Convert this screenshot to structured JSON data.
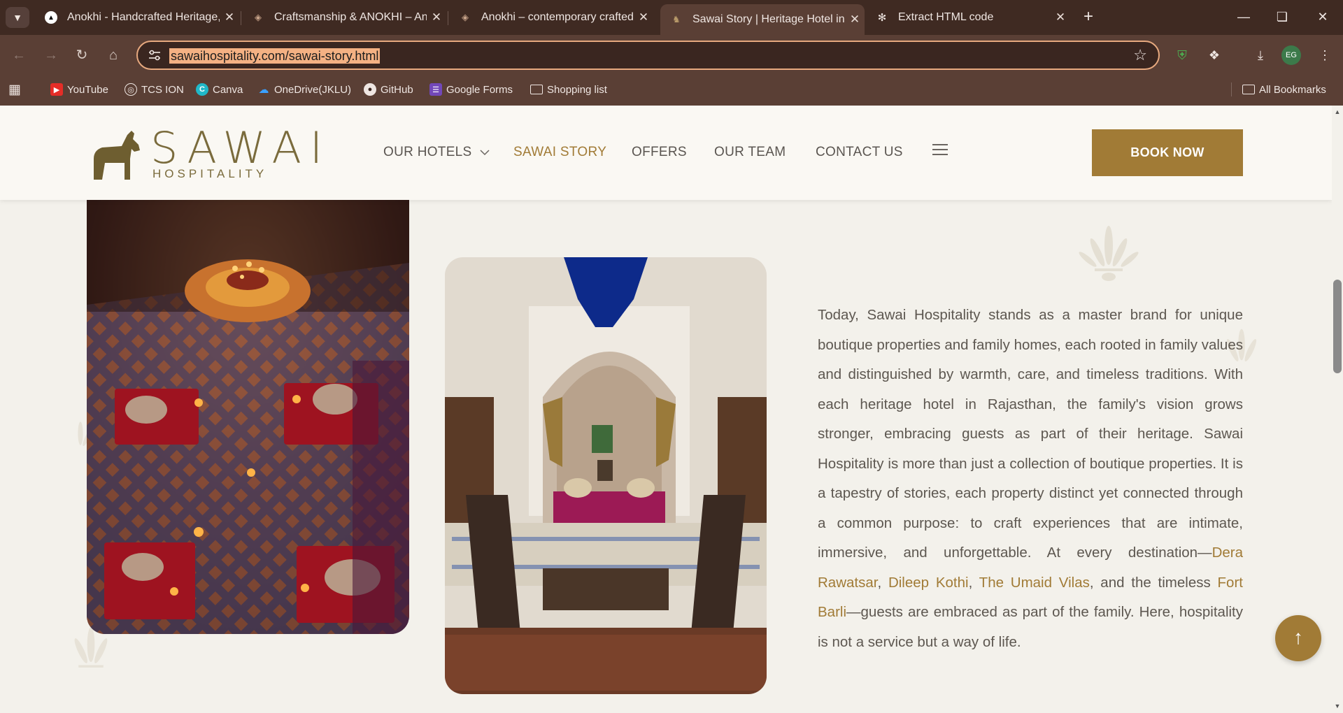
{
  "browser": {
    "tabs": [
      {
        "title": "Anokhi - Handcrafted Heritage,",
        "active": false
      },
      {
        "title": "Craftsmanship & ANOKHI – Anokhi",
        "active": false
      },
      {
        "title": "Anokhi – contemporary crafted",
        "active": false
      },
      {
        "title": "Sawai Story | Heritage Hotel in R",
        "active": true
      },
      {
        "title": "Extract HTML code",
        "active": false
      }
    ],
    "url": "sawaihospitality.com/sawai-story.html",
    "bookmarks": [
      {
        "label": "YouTube",
        "icon": "youtube-icon"
      },
      {
        "label": "TCS ION",
        "icon": "tcs-icon"
      },
      {
        "label": "Canva",
        "icon": "canva-icon"
      },
      {
        "label": "OneDrive(JKLU)",
        "icon": "onedrive-icon"
      },
      {
        "label": "GitHub",
        "icon": "github-icon"
      },
      {
        "label": "Google Forms",
        "icon": "forms-icon"
      },
      {
        "label": "Shopping list",
        "icon": "folder-icon"
      }
    ],
    "all_bookmarks": "All Bookmarks",
    "colors": {
      "frame": "#3f2a22",
      "toolbar": "#5a3f35",
      "url_highlight": "#f4b183"
    }
  },
  "site": {
    "logo": {
      "word": "SAWAI",
      "sub": "HOSPITALITY"
    },
    "nav": {
      "our_hotels": "OUR HOTELS",
      "sawai_story": "SAWAI STORY",
      "offers": "OFFERS",
      "our_team": "OUR TEAM",
      "contact_us": "CONTACT US"
    },
    "book_now": "BOOK NOW",
    "colors": {
      "accent": "#a17b36",
      "text": "#5d5750",
      "background": "#f3f1eb"
    },
    "story": {
      "p1": "Today, Sawai Hospitality stands as a master brand for unique boutique properties and family homes, each rooted in family values and distinguished by warmth, care, and timeless traditions. With each heritage hotel in Rajasthan, the family's vision grows stronger, embracing guests as part of their heritage. Sawai Hospitality is more than just a collection of boutique properties. It is a tapestry of stories, each property distinct yet connected through a common purpose: to craft experiences that are intimate, immersive, and unforgettable. At every destination—",
      "link1": "Dera Rawatsar",
      "sep1": ", ",
      "link2": "Dileep Kothi",
      "sep2": ", ",
      "link3": "The Umaid Vilas",
      "mid": ", and the timeless ",
      "link4": "Fort Barli",
      "end": "—guests are embraced as part of the family. Here, hospitality is not a service but a way of life."
    },
    "scroll_top_icon": "arrow-up-icon"
  }
}
